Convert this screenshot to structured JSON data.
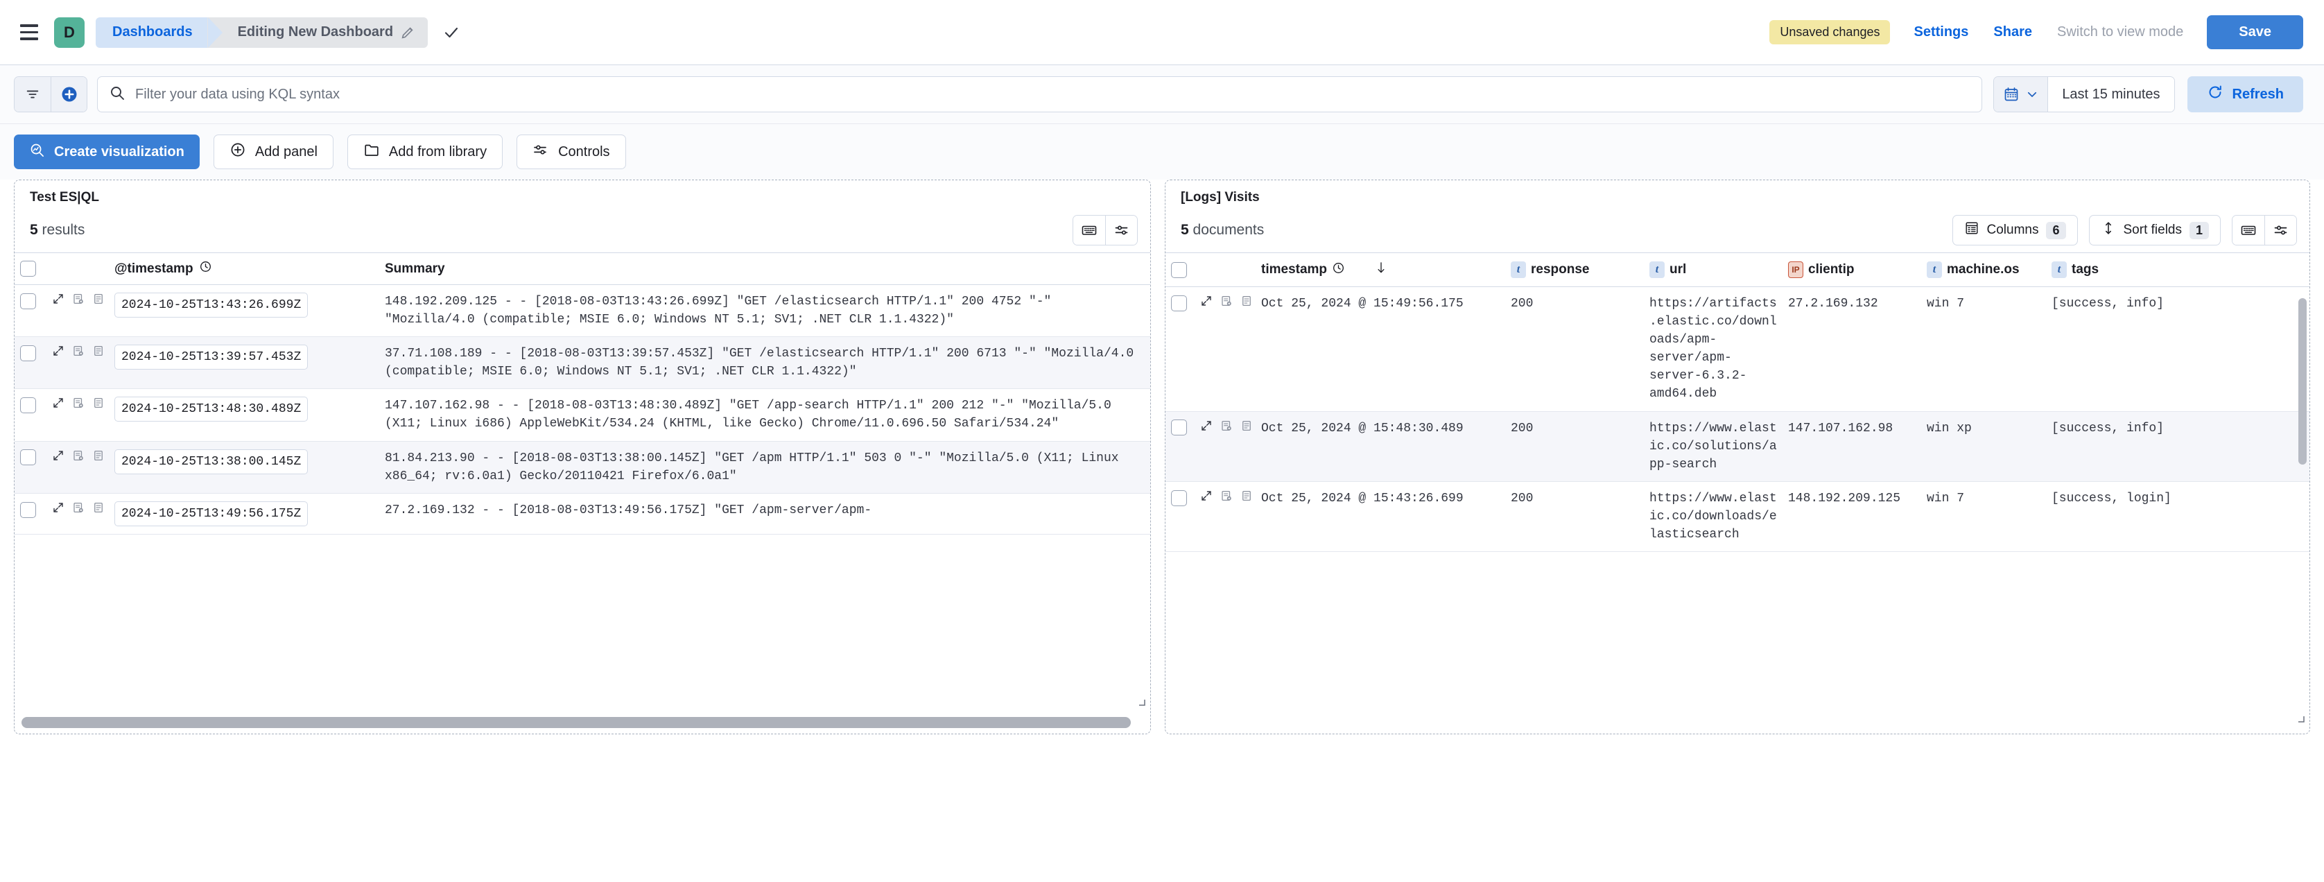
{
  "header": {
    "app_badge": "D",
    "breadcrumbs": [
      {
        "label": "Dashboards"
      },
      {
        "label": "Editing New Dashboard"
      }
    ],
    "unsaved_badge": "Unsaved changes",
    "settings_label": "Settings",
    "share_label": "Share",
    "view_mode_label": "Switch to view mode",
    "save_label": "Save",
    "colors": {
      "accent": "#0B64DD",
      "save_bg": "#3A7FD5",
      "badge_bg": "#F3E8A4",
      "app_badge_bg": "#54B399"
    }
  },
  "query_bar": {
    "placeholder": "Filter your data using KQL syntax",
    "time_range": "Last 15 minutes",
    "refresh_label": "Refresh"
  },
  "action_bar": {
    "create_visualization": "Create visualization",
    "add_panel": "Add panel",
    "add_from_library": "Add from library",
    "controls": "Controls"
  },
  "left_panel": {
    "title": "Test ES|QL",
    "count": "5",
    "count_label": "results",
    "columns": [
      "@timestamp",
      "Summary"
    ],
    "rows": [
      {
        "timestamp": "2024-10-25T13:43:26.699Z",
        "summary": "148.192.209.125 - - [2018-08-03T13:43:26.699Z] \"GET /elasticsearch HTTP/1.1\" 200 4752 \"-\" \"Mozilla/4.0 (compatible; MSIE 6.0; Windows NT 5.1; SV1; .NET CLR 1.1.4322)\""
      },
      {
        "timestamp": "2024-10-25T13:39:57.453Z",
        "summary": "37.71.108.189 - - [2018-08-03T13:39:57.453Z] \"GET /elasticsearch HTTP/1.1\" 200 6713 \"-\" \"Mozilla/4.0 (compatible; MSIE 6.0; Windows NT 5.1; SV1; .NET CLR 1.1.4322)\""
      },
      {
        "timestamp": "2024-10-25T13:48:30.489Z",
        "summary": "147.107.162.98 - - [2018-08-03T13:48:30.489Z] \"GET /app-search HTTP/1.1\" 200 212 \"-\" \"Mozilla/5.0 (X11; Linux i686) AppleWebKit/534.24 (KHTML, like Gecko) Chrome/11.0.696.50 Safari/534.24\""
      },
      {
        "timestamp": "2024-10-25T13:38:00.145Z",
        "summary": "81.84.213.90 - - [2018-08-03T13:38:00.145Z] \"GET /apm HTTP/1.1\" 503 0 \"-\" \"Mozilla/5.0 (X11; Linux x86_64; rv:6.0a1) Gecko/20110421 Firefox/6.0a1\""
      },
      {
        "timestamp": "2024-10-25T13:49:56.175Z",
        "summary": "27.2.169.132 - - [2018-08-03T13:49:56.175Z] \"GET /apm-server/apm-"
      }
    ]
  },
  "right_panel": {
    "title": "[Logs] Visits",
    "count": "5",
    "count_label": "documents",
    "columns_label": "Columns",
    "columns_count": "6",
    "sort_label": "Sort fields",
    "sort_count": "1",
    "columns": [
      {
        "label": "timestamp",
        "type": "date"
      },
      {
        "label": "response",
        "type": "t"
      },
      {
        "label": "url",
        "type": "t"
      },
      {
        "label": "clientip",
        "type": "ip"
      },
      {
        "label": "machine.os",
        "type": "t"
      },
      {
        "label": "tags",
        "type": "t"
      }
    ],
    "rows": [
      {
        "timestamp": "Oct 25, 2024 @ 15:49:56.175",
        "response": "200",
        "url": "https://artifacts.elastic.co/downloads/apm-server/apm-server-6.3.2-amd64.deb",
        "clientip": "27.2.169.132",
        "machine_os": "win 7",
        "tags": "[success, info]"
      },
      {
        "timestamp": "Oct 25, 2024 @ 15:48:30.489",
        "response": "200",
        "url": "https://www.elastic.co/solutions/app-search",
        "clientip": "147.107.162.98",
        "machine_os": "win xp",
        "tags": "[success, info]"
      },
      {
        "timestamp": "Oct 25, 2024 @ 15:43:26.699",
        "response": "200",
        "url": "https://www.elastic.co/downloads/elasticsearch",
        "clientip": "148.192.209.125",
        "machine_os": "win 7",
        "tags": "[success, login]"
      }
    ]
  }
}
